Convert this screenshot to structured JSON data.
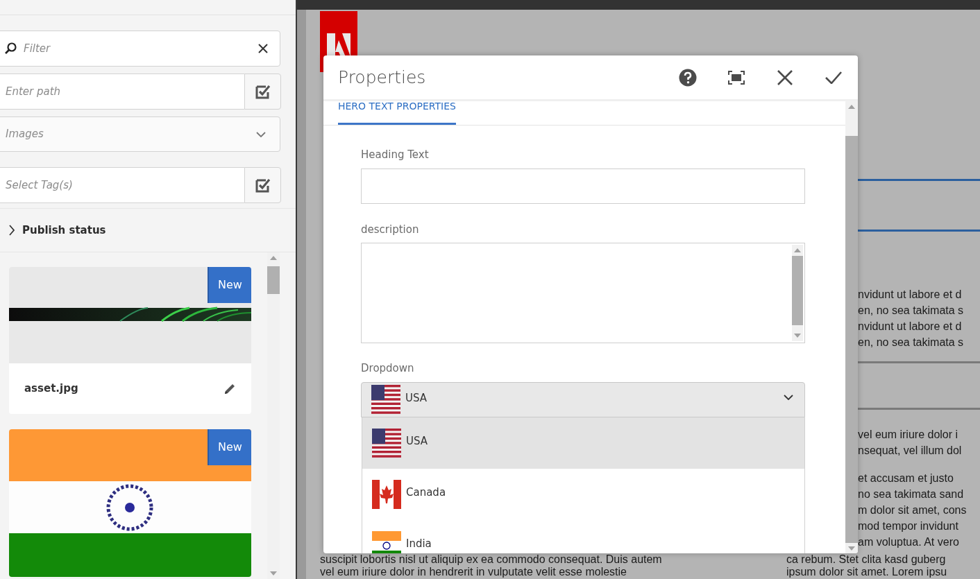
{
  "sidebar": {
    "filter": {
      "placeholder": "Filter"
    },
    "path": {
      "placeholder": "Enter path"
    },
    "asset_type": {
      "placeholder": "Images"
    },
    "tags": {
      "placeholder": "Select Tag(s)"
    },
    "publish_status": {
      "label": "Publish status",
      "expanded": false
    },
    "assets": [
      {
        "name": "asset.jpg",
        "badge": "New"
      },
      {
        "badge": "New"
      }
    ]
  },
  "page": {
    "right_column": [
      {
        "lines": [
          "nvidunt ut labore et d",
          "en, no sea takimata s",
          "nvidunt ut labore et d",
          "en, no sea takimata s"
        ]
      },
      {
        "lines": [
          "vel eum iriure dolor i",
          "nsequat, vel illum dol"
        ]
      },
      {
        "lines": [
          "et accusam et justo",
          "no sea takimata sand",
          "m dolor sit amet, cons",
          "mod tempor invidunt",
          "am voluptua. At vero"
        ]
      }
    ],
    "bottom_left": [
      "suscipit lobortis nisl ut aliquip ex ea commodo consequat. Duis autem",
      "vel eum iriure dolor in hendrerit in vulputate velit esse molestie"
    ],
    "bottom_right": [
      "ca rebum. Stet clita kasd guberg",
      "ipsum dolor sit amet. Lorem ipsu"
    ]
  },
  "dialog": {
    "title": "Properties",
    "tabs": [
      {
        "label": "HERO TEXT PROPERTIES",
        "selected": true
      }
    ],
    "fields": [
      {
        "kind": "text",
        "label": "Heading Text"
      },
      {
        "kind": "textarea",
        "label": "description"
      },
      {
        "kind": "select",
        "label": "Dropdown",
        "value": "USA",
        "expanded": true,
        "options": [
          {
            "label": "USA",
            "kind": "us",
            "selected": true
          },
          {
            "label": "Canada",
            "kind": "ca",
            "selected": false
          },
          {
            "label": "India",
            "kind": "in",
            "selected": false
          }
        ]
      }
    ]
  }
}
